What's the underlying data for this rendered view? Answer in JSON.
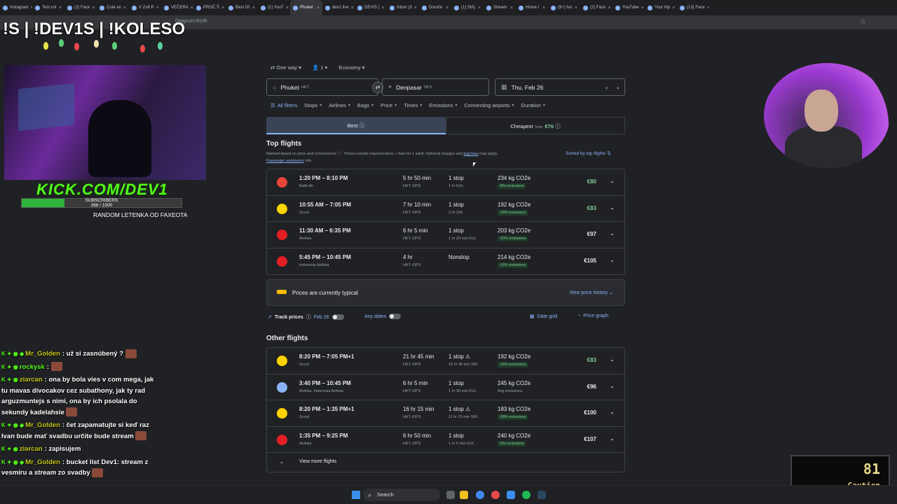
{
  "browser": {
    "tabs": [
      "Instagram",
      "Test vol",
      "(2) Face",
      "Cute an",
      "V Zo8 P",
      "VEČERA",
      "PROČ Š",
      "Best Of",
      "(1) YouT",
      "Phuket",
      "dev1.live",
      "DEVIS |",
      "Inbox (3",
      "Doruče",
      "(1) Stříj",
      "Stream",
      "Home /",
      "(9+) Ivo",
      "(2) Face",
      "YouTube",
      "Your trip",
      "(13) Face"
    ],
    "active_tab_index": 9,
    "url_fragment": "Gtvgcurr=EUR"
  },
  "overlay": {
    "title": "!S | !DEV1S | !KOLESO",
    "kick": "KICK.COM/DEV1",
    "subscribers_label": "SUBSCRIBERS",
    "subscribers_count": "266 / 1000",
    "subscribers_fraction": 0.266,
    "random_label": "RANDOM LETENKA OD FAXEOTA",
    "caution_number": "81",
    "caution_label": "Caution"
  },
  "chat": [
    {
      "badges": "K ✦ ◉ ◆",
      "user": "Mr_Golden",
      "user_color": "#c8c81a",
      "text": ": už si zasnúbený ?",
      "emote": true
    },
    {
      "badges": "K ✦ ◉",
      "user": "rockysk",
      "user_color": "#53fc18",
      "text": ":",
      "emote": true
    },
    {
      "badges": "K ✦ ◉",
      "user": "ziarcan",
      "user_color": "#c8c81a",
      "text": ": ona by bola vies v com mega, jak tu mavas divocakov cez subathony, jak ty rad arguzmuntejs s nimi, ona by ich psolala do sekundy kadelahsie",
      "emote": true
    },
    {
      "badges": "K ✦ ◉ ◆",
      "user": "Mr_Golden",
      "user_color": "#c8c81a",
      "text": ": čet zapamatujte si keď raz Ivan bude mať svadbu určite bude stream",
      "emote": true
    },
    {
      "badges": "K ✦ ◉",
      "user": "ziarcan",
      "user_color": "#c8c81a",
      "text": ": zapisujem",
      "emote": false
    },
    {
      "badges": "K ✦ ◉ ◆",
      "user": "Mr_Golden",
      "user_color": "#c8c81a",
      "text": ": bucket list Dev1: stream z vesmíru a stream zo svadby",
      "emote": true
    }
  ],
  "search": {
    "trip_type": "One way",
    "passengers": "1",
    "cabin": "Economy",
    "origin": "Phuket",
    "origin_code": "HKT",
    "destination": "Denpasar",
    "destination_code": "DPS",
    "date": "Thu, Feb 26"
  },
  "filters": [
    "All filters",
    "Stops",
    "Airlines",
    "Bags",
    "Price",
    "Times",
    "Emissions",
    "Connecting airports",
    "Duration"
  ],
  "sort_tabs": {
    "best": "Best",
    "cheapest": "Cheapest",
    "from": "from",
    "cheapest_price": "€76"
  },
  "top": {
    "heading": "Top flights",
    "note_a": "Ranked based on price and convenience",
    "note_b": "Prices include required taxes + fees for 1 adult. Optional charges and",
    "note_link": "bag fees",
    "note_c": "may apply.",
    "passenger_link": "Passenger assistance",
    "passenger_suffix": "info.",
    "sorted": "Sorted by top flights"
  },
  "top_flights": [
    {
      "time": "1:20 PM – 8:10 PM",
      "airline": "Batik Air",
      "duration": "5 hr 50 min",
      "route": "HKT–DPS",
      "stops": "1 stop",
      "stop_detail": "1 hr KUL",
      "co2": "234 kg CO2e",
      "emissions": "-8% emissions",
      "price": "€80",
      "cheap": true,
      "logo_color": "#e8453c"
    },
    {
      "time": "10:55 AM – 7:05 PM",
      "airline": "Scoot",
      "duration": "7 hr 10 min",
      "route": "HKT–DPS",
      "stops": "1 stop",
      "stop_detail": "2 hr SIN",
      "co2": "192 kg CO2e",
      "emissions": "-24% emissions",
      "price": "€83",
      "cheap": true,
      "logo_color": "#ffd400"
    },
    {
      "time": "11:30 AM – 6:35 PM",
      "airline": "AirAsia",
      "duration": "6 hr 5 min",
      "route": "HKT–DPS",
      "stops": "1 stop",
      "stop_detail": "1 hr 20 min KUL",
      "co2": "203 kg CO2e",
      "emissions": "-20% emissions",
      "price": "€97",
      "cheap": false,
      "logo_color": "#e31e24"
    },
    {
      "time": "5:45 PM – 10:45 PM",
      "airline": "Indonesia AirAsia",
      "duration": "4 hr",
      "route": "HKT–DPS",
      "stops": "Nonstop",
      "stop_detail": "",
      "co2": "214 kg CO2e",
      "emissions": "-16% emissions",
      "price": "€105",
      "cheap": false,
      "logo_color": "#e31e24"
    }
  ],
  "typical": {
    "text": "Prices are currently typical",
    "link": "View price history"
  },
  "track": {
    "label": "Track prices",
    "date": "Feb 26",
    "any_dates": "Any dates",
    "date_grid": "Date grid",
    "price_graph": "Price graph"
  },
  "other": {
    "heading": "Other flights",
    "more": "View more flights"
  },
  "other_flights": [
    {
      "time": "8:20 PM – 7:05 PM+1",
      "airline": "Scoot",
      "duration": "21 hr 45 min",
      "route": "HKT–DPS",
      "stops": "1 stop ⚠",
      "stop_detail": "16 hr 40 min SIN",
      "co2": "192 kg CO2e",
      "emissions": "-24% emissions",
      "price": "€83",
      "cheap": true,
      "logo_color": "#ffd400",
      "avg": false
    },
    {
      "time": "3:40 PM – 10:45 PM",
      "airline": "AirAsia, Indonesia AirAsia",
      "duration": "6 hr 5 min",
      "route": "HKT–DPS",
      "stops": "1 stop",
      "stop_detail": "1 hr 30 min KUL",
      "co2": "245 kg CO2e",
      "emissions": "Avg emissions",
      "price": "€96",
      "cheap": false,
      "logo_color": "#8ab4f8",
      "avg": true
    },
    {
      "time": "8:20 PM – 1:35 PM+1",
      "airline": "Scoot",
      "duration": "16 hr 15 min",
      "route": "HKT–DPS",
      "stops": "1 stop ⚠",
      "stop_detail": "11 hr 25 min SIN",
      "co2": "183 kg CO2e",
      "emissions": "-28% emissions",
      "price": "€100",
      "cheap": false,
      "logo_color": "#ffd400",
      "avg": false
    },
    {
      "time": "1:35 PM – 9:25 PM",
      "airline": "AirAsia",
      "duration": "6 hr 50 min",
      "route": "HKT–DPS",
      "stops": "1 stop",
      "stop_detail": "1 hr 5 min KUL",
      "co2": "240 kg CO2e",
      "emissions": "-6% emissions",
      "price": "€107",
      "cheap": false,
      "logo_color": "#e31e24",
      "avg": false
    }
  ],
  "taskbar": {
    "search": "Search"
  }
}
